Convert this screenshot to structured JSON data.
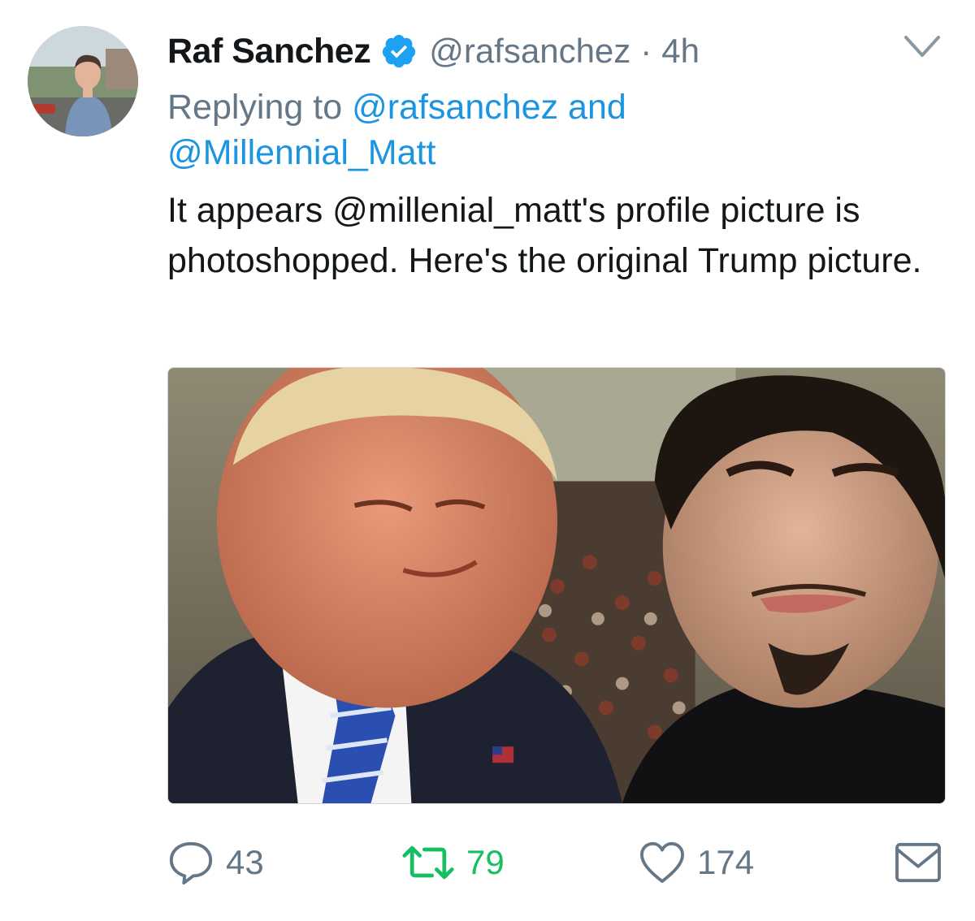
{
  "author": {
    "name": "Raf Sanchez",
    "handle": "@rafsanchez",
    "separator": "·",
    "time": "4h",
    "verified": true
  },
  "reply": {
    "label": "Replying to",
    "first": "@rafsanchez",
    "conj": "and",
    "second": "@Millennial_Matt"
  },
  "text": "It appears @millenial_matt's profile picture is photoshopped. Here's the original Trump picture.",
  "actions": {
    "replies": "43",
    "retweets": "79",
    "likes": "174"
  },
  "icons": {
    "verified": "verified-badge-icon",
    "menu": "chevron-down-icon",
    "reply": "reply-icon",
    "retweet": "retweet-icon",
    "like": "heart-icon",
    "dm": "envelope-icon"
  },
  "colors": {
    "link": "#1b95e0",
    "muted": "#657786",
    "retweet": "#17bf63",
    "text": "#14171a"
  }
}
